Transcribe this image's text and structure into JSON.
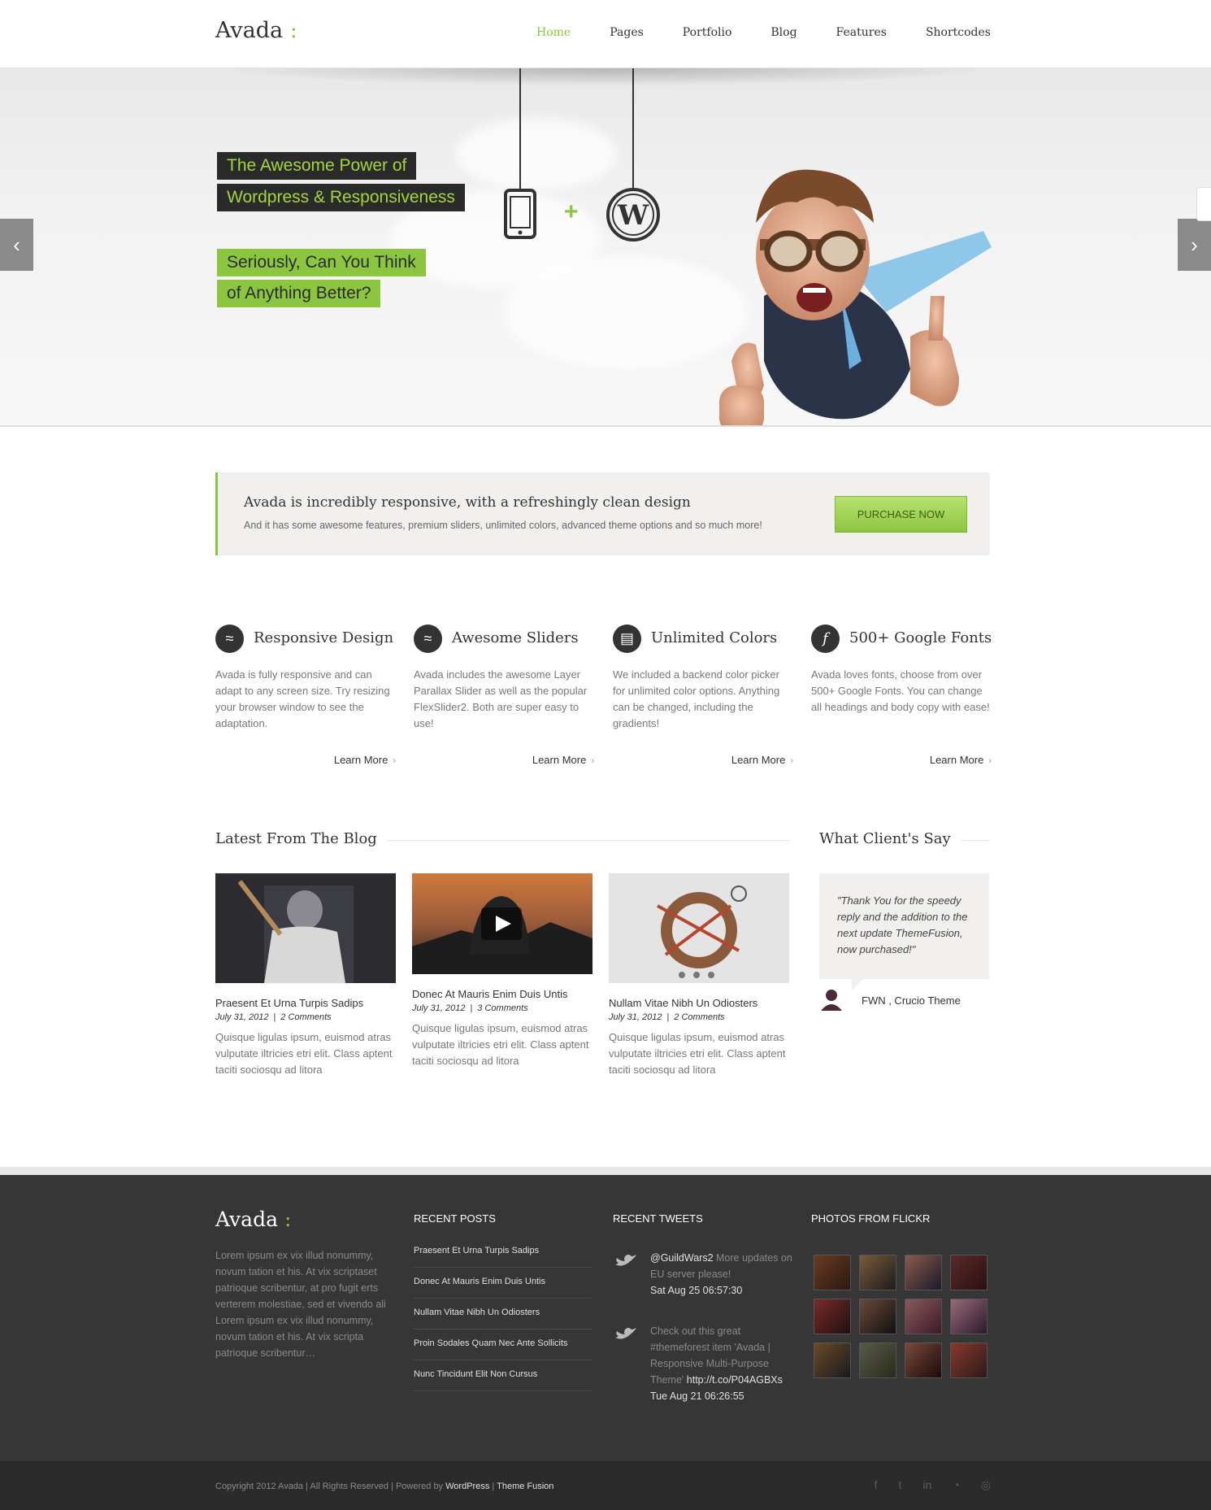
{
  "header": {
    "logo_text": "Avada",
    "logo_mark": ":",
    "nav": [
      "Home",
      "Pages",
      "Portfolio",
      "Blog",
      "Features",
      "Shortcodes"
    ],
    "active": "Home"
  },
  "slider": {
    "line1": "The Awesome Power of",
    "line2": "Wordpress & Responsiveness",
    "line3": "Seriously, Can You Think",
    "line4": "of Anything Better?",
    "plus": "+",
    "prev": "‹",
    "next": "›"
  },
  "callout": {
    "title": "Avada is incredibly responsive, with a refreshingly clean design",
    "text": "And it has some awesome features, premium sliders, unlimited colors, advanced theme options and so much more!",
    "button": "PURCHASE NOW"
  },
  "features": [
    {
      "title": "Responsive Design",
      "icon": "responsive-icon",
      "text": "Avada is fully responsive and can adapt to any screen size. Try resizing your browser window to see the adaptation.",
      "link": "Learn More"
    },
    {
      "title": "Awesome Sliders",
      "icon": "sliders-icon",
      "text": "Avada includes the awesome Layer Parallax Slider as well as the popular FlexSlider2. Both are super easy to use!",
      "link": "Learn More"
    },
    {
      "title": "Unlimited Colors",
      "icon": "colors-icon",
      "text": "We included a backend color picker for unlimited color options. Anything can be changed, including the gradients!",
      "link": "Learn More"
    },
    {
      "title": "500+ Google Fonts",
      "icon": "fonts-icon",
      "text": "Avada loves fonts, choose from over 500+ Google Fonts. You can change all headings and body copy with ease!",
      "link": "Learn More"
    }
  ],
  "blog": {
    "title": "Latest From The Blog",
    "posts": [
      {
        "title": "Praesent Et Urna Turpis Sadips",
        "date": "July 31, 2012",
        "comments": "2 Comments",
        "excerpt": "Quisque ligulas ipsum, euismod atras vulputate iltricies etri elit. Class aptent taciti sociosqu ad litora"
      },
      {
        "title": "Donec At Mauris Enim Duis Untis",
        "date": "July 31, 2012",
        "comments": "3 Comments",
        "excerpt": "Quisque ligulas ipsum, euismod atras vulputate iltricies etri elit. Class aptent taciti sociosqu ad litora"
      },
      {
        "title": "Nullam Vitae Nibh Un Odiosters",
        "date": "July 31, 2012",
        "comments": "2 Comments",
        "excerpt": "Quisque ligulas ipsum, euismod atras vulputate iltricies etri elit. Class aptent taciti sociosqu ad litora"
      }
    ]
  },
  "testimonial": {
    "title": "What Client's Say",
    "quote": "\"Thank You for the speedy reply and the addition to the next update ThemeFusion, now purchased!\"",
    "author": "FWN , Crucio Theme"
  },
  "footer": {
    "logo_text": "Avada",
    "logo_mark": ":",
    "about": "Lorem ipsum ex vix illud nonummy, novum tation et his. At vix scriptaset patrioque scribentur, at pro fugit erts verterem molestiae, sed et vivendo ali Lorem ipsum ex vix illud nonummy, novum tation et his. At vix scripta patrioque scribentur…",
    "recent_posts_title": "RECENT POSTS",
    "recent_posts": [
      "Praesent Et Urna Turpis Sadips",
      "Donec At Mauris Enim Duis Untis",
      "Nullam Vitae Nibh Un Odiosters",
      "Proin Sodales Quam Nec Ante Sollicits",
      "Nunc Tincidunt Elit Non Cursus"
    ],
    "tweets_title": "RECENT TWEETS",
    "tweet1_handle": "@GuildWars2",
    "tweet1_text": "More updates on EU server please!",
    "tweet1_time": "Sat Aug 25 06:57:30",
    "tweet2_text": "Check out this great #themeforest item 'Avada | Responsive Multi-Purpose Theme'",
    "tweet2_link": "http://t.co/P04AGBXs",
    "tweet2_time": "Tue Aug 21 06:26:55",
    "flickr_title": "PHOTOS FROM FLICKR",
    "copyright_pre": "Copyright 2012 Avada | All Rights Reserved | Powered by",
    "copyright_wp": "WordPress",
    "copyright_sep": "|",
    "copyright_tf": "Theme Fusion",
    "social_icons": [
      "facebook-icon",
      "twitter-icon",
      "linkedin-icon",
      "rss-icon",
      "dribbble-icon"
    ]
  },
  "colors": {
    "accent": "#8cc63f",
    "footer": "#363636"
  }
}
